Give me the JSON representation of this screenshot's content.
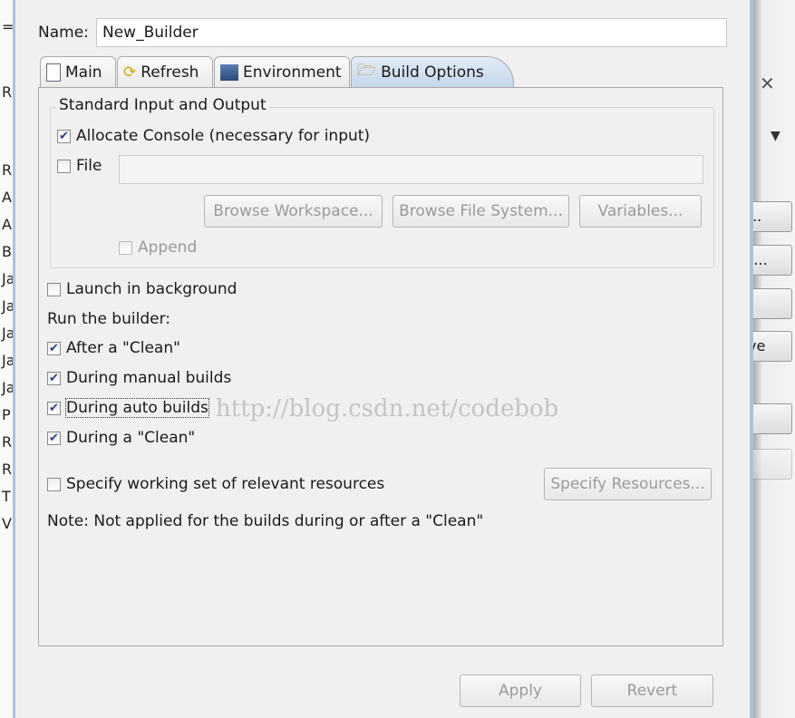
{
  "background_letters": [
    "R",
    "A",
    "A",
    "B",
    "Ja",
    "Ja",
    "Ja",
    "Ja",
    "Ja",
    "P",
    "R",
    "R",
    "T",
    "V"
  ],
  "background_right_buttons": [
    "...",
    "t...",
    ".",
    "ve",
    "",
    ""
  ],
  "name_label": "Name:",
  "name_value": "New_Builder",
  "tabs": [
    {
      "label": "Main",
      "icon": "document-icon"
    },
    {
      "label": "Refresh",
      "icon": "refresh-icon"
    },
    {
      "label": "Environment",
      "icon": "environment-icon"
    },
    {
      "label": "Build Options",
      "icon": "folder-open-icon",
      "active": true
    }
  ],
  "group": {
    "title": "Standard Input and Output",
    "allocate_console": {
      "label": "Allocate Console (necessary for input)",
      "checked": true
    },
    "file": {
      "label": "File",
      "checked": false,
      "value": ""
    },
    "buttons": [
      "Browse Workspace...",
      "Browse File System...",
      "Variables..."
    ],
    "append": {
      "label": "Append",
      "checked": false
    }
  },
  "launch_background": {
    "label": "Launch in background",
    "checked": false
  },
  "run_builder_label": "Run the builder:",
  "run_options": [
    {
      "label": "After a \"Clean\"",
      "checked": true
    },
    {
      "label": "During manual builds",
      "checked": true
    },
    {
      "label": "During auto builds",
      "checked": true
    },
    {
      "label": "During a \"Clean\"",
      "checked": true
    }
  ],
  "working_set": {
    "label": "Specify working set of relevant resources",
    "checked": false,
    "button": "Specify Resources..."
  },
  "note": "Note: Not applied for the builds during or after a \"Clean\"",
  "apply_label": "Apply",
  "revert_label": "Revert",
  "watermark": "http://blog.csdn.net/codebob",
  "close_icon": "close-icon",
  "accent": "#a9c3e0"
}
